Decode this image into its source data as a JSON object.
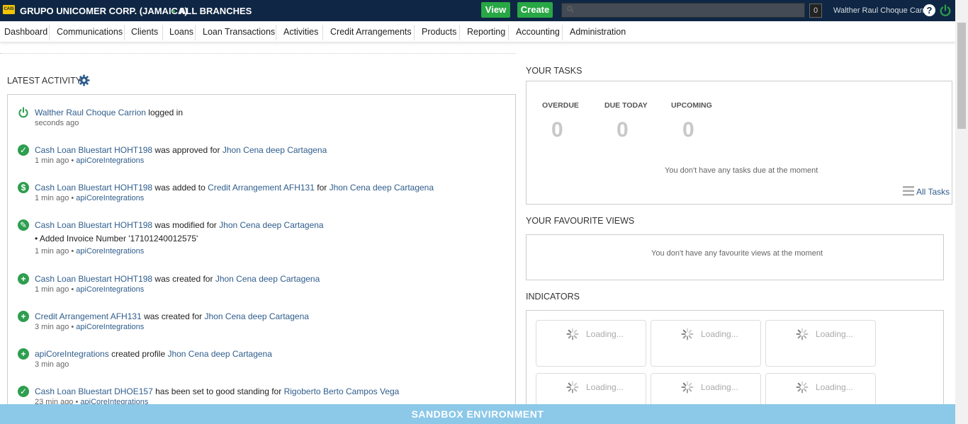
{
  "header": {
    "logo_text": "CAIS",
    "org_name": "GRUPO UNICOMER CORP. (JAMAICA)",
    "branch": "ALL BRANCHES",
    "view_label": "View",
    "create_label": "Create",
    "search_placeholder": "",
    "counter": "0",
    "user_name": "Walther Raul Choque Carrion",
    "help_label": "?"
  },
  "nav": [
    "Dashboard",
    "Communications",
    "Clients",
    "Loans",
    "Loan Transactions",
    "Activities",
    "Credit Arrangements",
    "Products",
    "Reporting",
    "Accounting",
    "Administration"
  ],
  "latest_activity": {
    "title": "LATEST ACTIVITY",
    "items": [
      {
        "icon": "power-icon",
        "parts": [
          {
            "link": "Walther Raul Choque Carrion"
          },
          {
            "text": " logged in"
          }
        ],
        "meta_time": "seconds ago",
        "meta_user": ""
      },
      {
        "icon": "check-icon",
        "parts": [
          {
            "link": "Cash Loan Bluestart HOHT198"
          },
          {
            "text": " was approved for "
          },
          {
            "link": "Jhon Cena deep Cartagena"
          }
        ],
        "meta_time": "1 min ago",
        "meta_user": "apiCoreIntegrations"
      },
      {
        "icon": "dollar-icon",
        "parts": [
          {
            "link": "Cash Loan Bluestart HOHT198"
          },
          {
            "text": " was added to "
          },
          {
            "link": "Credit Arrangement AFH131"
          },
          {
            "text": " for "
          },
          {
            "link": "Jhon Cena deep Cartagena"
          }
        ],
        "meta_time": "1 min ago",
        "meta_user": "apiCoreIntegrations"
      },
      {
        "icon": "pencil-icon",
        "parts": [
          {
            "link": "Cash Loan Bluestart HOHT198"
          },
          {
            "text": " was modified for "
          },
          {
            "link": "Jhon Cena deep Cartagena"
          }
        ],
        "bullet": "Added Invoice Number '17101240012575'",
        "meta_time": "1 min ago",
        "meta_user": "apiCoreIntegrations"
      },
      {
        "icon": "plus-icon",
        "parts": [
          {
            "link": "Cash Loan Bluestart HOHT198"
          },
          {
            "text": " was created for "
          },
          {
            "link": "Jhon Cena deep Cartagena"
          }
        ],
        "meta_time": "1 min ago",
        "meta_user": "apiCoreIntegrations"
      },
      {
        "icon": "plus-icon",
        "parts": [
          {
            "link": "Credit Arrangement AFH131"
          },
          {
            "text": " was created for "
          },
          {
            "link": "Jhon Cena deep Cartagena"
          }
        ],
        "meta_time": "3 min ago",
        "meta_user": "apiCoreIntegrations"
      },
      {
        "icon": "plus-icon",
        "parts": [
          {
            "link": "apiCoreIntegrations"
          },
          {
            "text": " created profile "
          },
          {
            "link": "Jhon Cena deep Cartagena"
          }
        ],
        "meta_time": "3 min ago",
        "meta_user": ""
      },
      {
        "icon": "check-icon",
        "parts": [
          {
            "link": "Cash Loan Bluestart DHOE157"
          },
          {
            "text": " has been set to good standing for "
          },
          {
            "link": "Rigoberto Berto Campos Vega"
          }
        ],
        "meta_time": "23 min ago",
        "meta_user": "apiCoreIntegrations"
      }
    ]
  },
  "tasks": {
    "title": "YOUR TASKS",
    "overdue_label": "OVERDUE",
    "overdue": "0",
    "due_today_label": "DUE TODAY",
    "due_today": "0",
    "upcoming_label": "UPCOMING",
    "upcoming": "0",
    "empty_message": "You don't have any tasks due at the moment",
    "all_tasks_label": "All Tasks"
  },
  "favourites": {
    "title": "YOUR FAVOURITE VIEWS",
    "empty_message": "You don't have any favourite views at the moment"
  },
  "indicators": {
    "title": "INDICATORS",
    "loading_label": "Loading..."
  },
  "footer": {
    "environment": "SANDBOX ENVIRONMENT"
  },
  "colors": {
    "topbar": "#0f2744",
    "accent_green": "#28a745",
    "link": "#2f5d8c",
    "sandbox": "#8cc8e8"
  }
}
